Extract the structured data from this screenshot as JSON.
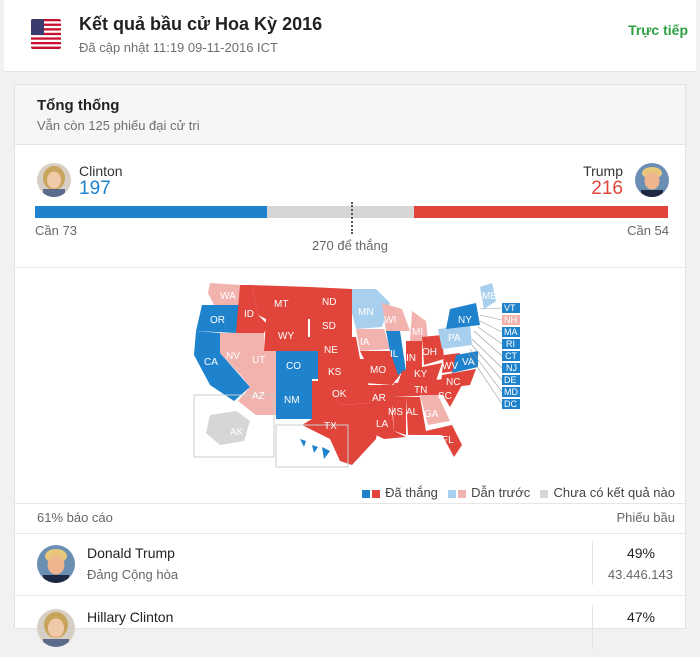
{
  "header": {
    "title": "Kết quả bầu cử Hoa Kỳ 2016",
    "updated": "Đã cập nhật 11:19 09-11-2016 ICT",
    "live": "Trực tiếp",
    "flag_icon": "us-flag-icon"
  },
  "president": {
    "title": "Tổng thống",
    "subtitle": "Vẫn còn 125 phiếu đại cử tri",
    "clinton": {
      "name": "Clinton",
      "votes": "197",
      "need": "Cần 73",
      "color": "#1f82cc"
    },
    "trump": {
      "name": "Trump",
      "votes": "216",
      "need": "Cần 54",
      "color": "#e0443a"
    },
    "to_win": "270 để thắng",
    "uncalled_color": "#d6d6d6"
  },
  "map": {
    "state_labels": [
      "WA",
      "OR",
      "CA",
      "NV",
      "ID",
      "MT",
      "WY",
      "UT",
      "AZ",
      "CO",
      "NM",
      "ND",
      "SD",
      "NE",
      "KS",
      "OK",
      "TX",
      "MN",
      "IA",
      "MO",
      "AR",
      "LA",
      "WI",
      "IL",
      "MI",
      "IN",
      "OH",
      "KY",
      "TN",
      "MS",
      "AL",
      "GA",
      "FL",
      "SC",
      "NC",
      "VA",
      "WV",
      "PA",
      "NY",
      "ME",
      "AK",
      "HI"
    ],
    "east_labels": [
      "VT",
      "NH",
      "MA",
      "RI",
      "CT",
      "NJ",
      "DE",
      "MD",
      "DC"
    ]
  },
  "legend": {
    "won": "Đã thắng",
    "leading": "Dẫn trước",
    "none": "Chưa có kết quả nào",
    "colors": {
      "dem_won": "#1f82cc",
      "rep_won": "#e0443a",
      "dem_lead": "#a8d0ee",
      "rep_lead": "#f2b3ae",
      "none": "#d6d6d6"
    }
  },
  "results": {
    "reporting": "61% báo cáo",
    "votes_header": "Phiếu bầu",
    "rows": [
      {
        "name": "Donald Trump",
        "party": "Đảng Cộng hòa",
        "pct": "49%",
        "votes": "43.446.143"
      },
      {
        "name": "Hillary Clinton",
        "party": "",
        "pct": "47%",
        "votes": ""
      }
    ]
  }
}
